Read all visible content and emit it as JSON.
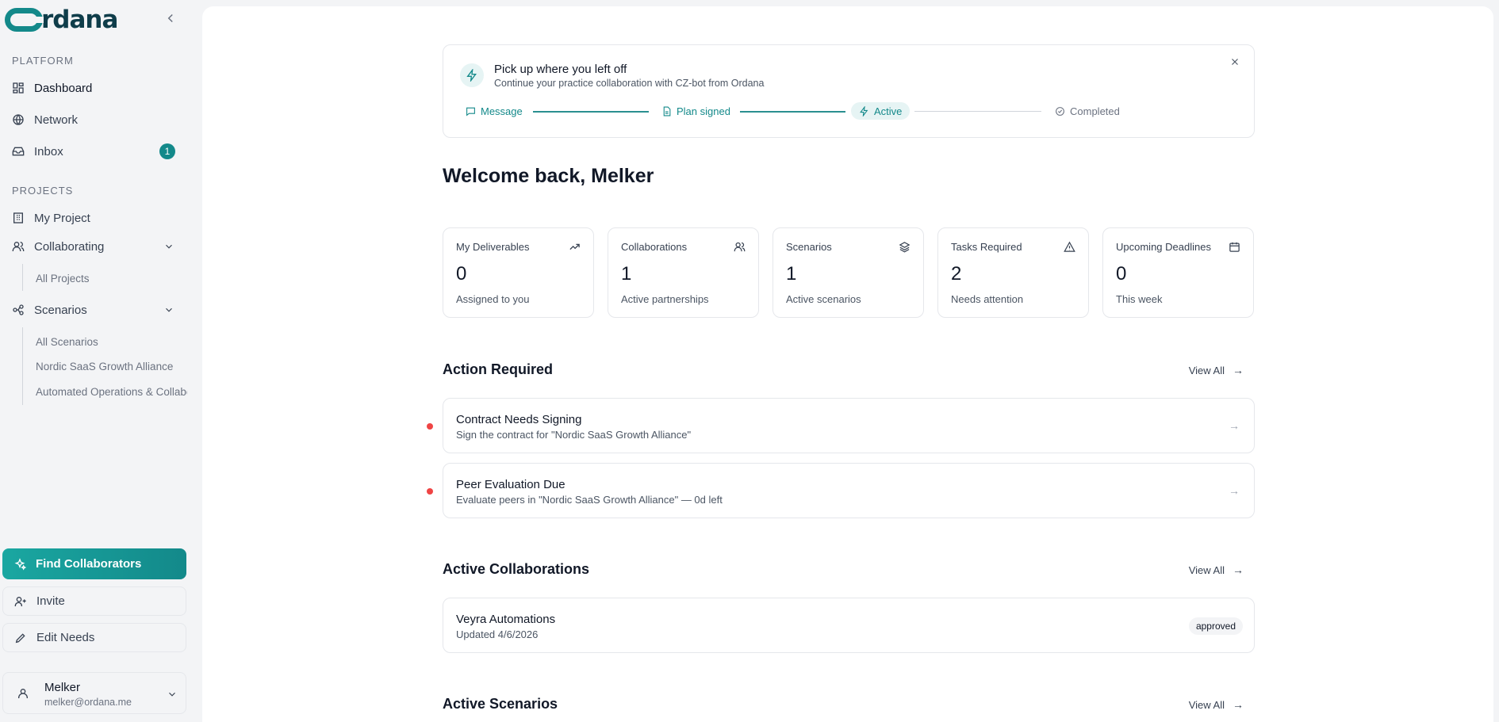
{
  "brand": {
    "name": "rdana",
    "accent": "#13898a"
  },
  "sidebar": {
    "platform_label": "PLATFORM",
    "platform_items": [
      {
        "label": "Dashboard",
        "icon": "dashboard-icon"
      },
      {
        "label": "Network",
        "icon": "globe-icon"
      },
      {
        "label": "Inbox",
        "icon": "inbox-icon",
        "badge": "1"
      }
    ],
    "projects_label": "PROJECTS",
    "my_project": "My Project",
    "collaborating": {
      "label": "Collaborating",
      "sub": [
        "All Projects"
      ]
    },
    "scenarios": {
      "label": "Scenarios",
      "sub": [
        "All Scenarios",
        "Nordic SaaS Growth Alliance",
        "Automated Operations & Collaboration"
      ]
    },
    "find_collaborators": "Find Collaborators",
    "invite": "Invite",
    "edit_needs": "Edit Needs",
    "user": {
      "name": "Melker",
      "email": "melker@ordana.me"
    }
  },
  "resume": {
    "title": "Pick up where you left off",
    "subtitle": "Continue your practice collaboration with CZ-bot from Ordana",
    "steps": [
      "Message",
      "Plan signed",
      "Active",
      "Completed"
    ]
  },
  "welcome": "Welcome back, Melker",
  "stats": [
    {
      "label": "My Deliverables",
      "value": "0",
      "desc": "Assigned to you",
      "icon": "trending-up-icon"
    },
    {
      "label": "Collaborations",
      "value": "1",
      "desc": "Active partnerships",
      "icon": "users-icon"
    },
    {
      "label": "Scenarios",
      "value": "1",
      "desc": "Active scenarios",
      "icon": "layers-icon"
    },
    {
      "label": "Tasks Required",
      "value": "2",
      "desc": "Needs attention",
      "icon": "alert-triangle-icon"
    },
    {
      "label": "Upcoming Deadlines",
      "value": "0",
      "desc": "This week",
      "icon": "calendar-icon"
    }
  ],
  "action_required": {
    "title": "Action Required",
    "view_all": "View All",
    "items": [
      {
        "title": "Contract Needs Signing",
        "subtitle": "Sign the contract for \"Nordic SaaS Growth Alliance\""
      },
      {
        "title": "Peer Evaluation Due",
        "subtitle": "Evaluate peers in \"Nordic SaaS Growth Alliance\" — 0d left"
      }
    ]
  },
  "active_collaborations": {
    "title": "Active Collaborations",
    "view_all": "View All",
    "items": [
      {
        "title": "Veyra Automations",
        "subtitle": "Updated 4/6/2026",
        "status": "approved"
      }
    ]
  },
  "active_scenarios": {
    "title": "Active Scenarios",
    "view_all": "View All"
  }
}
